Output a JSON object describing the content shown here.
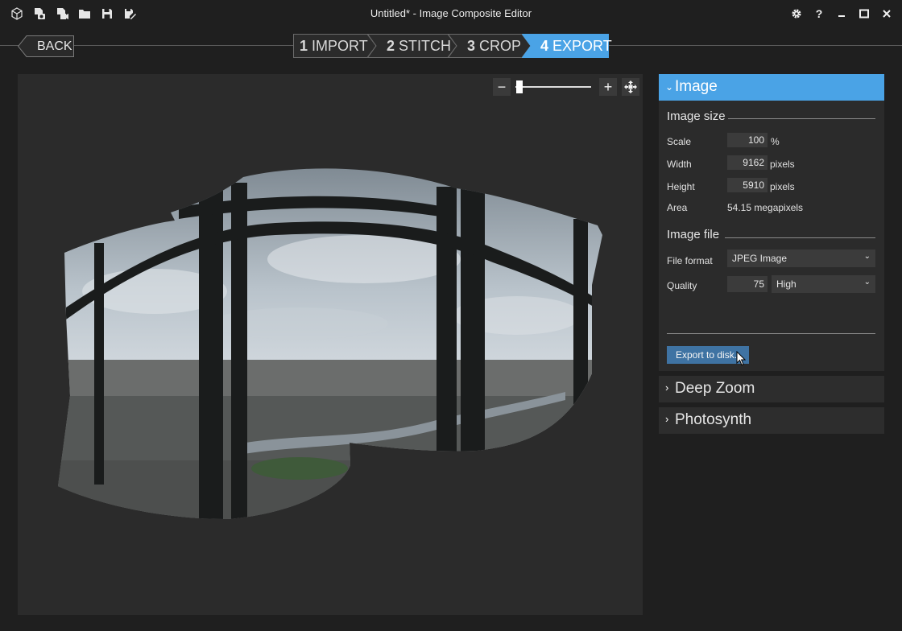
{
  "app": {
    "title": "Untitled* - Image Composite Editor"
  },
  "quick_access": [
    {
      "icon": "new-project-icon"
    },
    {
      "icon": "new-panorama-from-images-icon"
    },
    {
      "icon": "new-panorama-from-video-icon"
    },
    {
      "icon": "open-project-icon"
    },
    {
      "icon": "save-project-icon"
    },
    {
      "icon": "save-as-icon"
    }
  ],
  "window_controls": [
    "settings-icon",
    "help-icon",
    "minimize-icon",
    "maximize-icon",
    "close-icon"
  ],
  "nav": {
    "back_label": "BACK",
    "steps": [
      {
        "num": "1",
        "label": "IMPORT"
      },
      {
        "num": "2",
        "label": "STITCH"
      },
      {
        "num": "3",
        "label": "CROP"
      },
      {
        "num": "4",
        "label": "EXPORT"
      }
    ],
    "active_step": 4
  },
  "colors": {
    "accent": "#4aa3e6",
    "export_button": "#3f73a3",
    "panel_bg": "#2b2b2b",
    "window_bg": "#1f1f1f"
  },
  "zoom": {
    "minus": "−",
    "plus": "+",
    "level_fraction": 0.02
  },
  "panel": {
    "image_section": {
      "title": "Image",
      "size_group": "Image size",
      "scale_label": "Scale",
      "scale_value": "100",
      "scale_unit": "%",
      "width_label": "Width",
      "width_value": "9162",
      "width_unit": "pixels",
      "height_label": "Height",
      "height_value": "5910",
      "height_unit": "pixels",
      "area_label": "Area",
      "area_value": "54.15 megapixels",
      "file_group": "Image file",
      "format_label": "File format",
      "format_value": "JPEG Image",
      "quality_label": "Quality",
      "quality_value": "75",
      "quality_level": "High",
      "export_label": "Export to disk..."
    },
    "deep_zoom": {
      "title": "Deep Zoom"
    },
    "photosynth": {
      "title": "Photosynth"
    }
  }
}
